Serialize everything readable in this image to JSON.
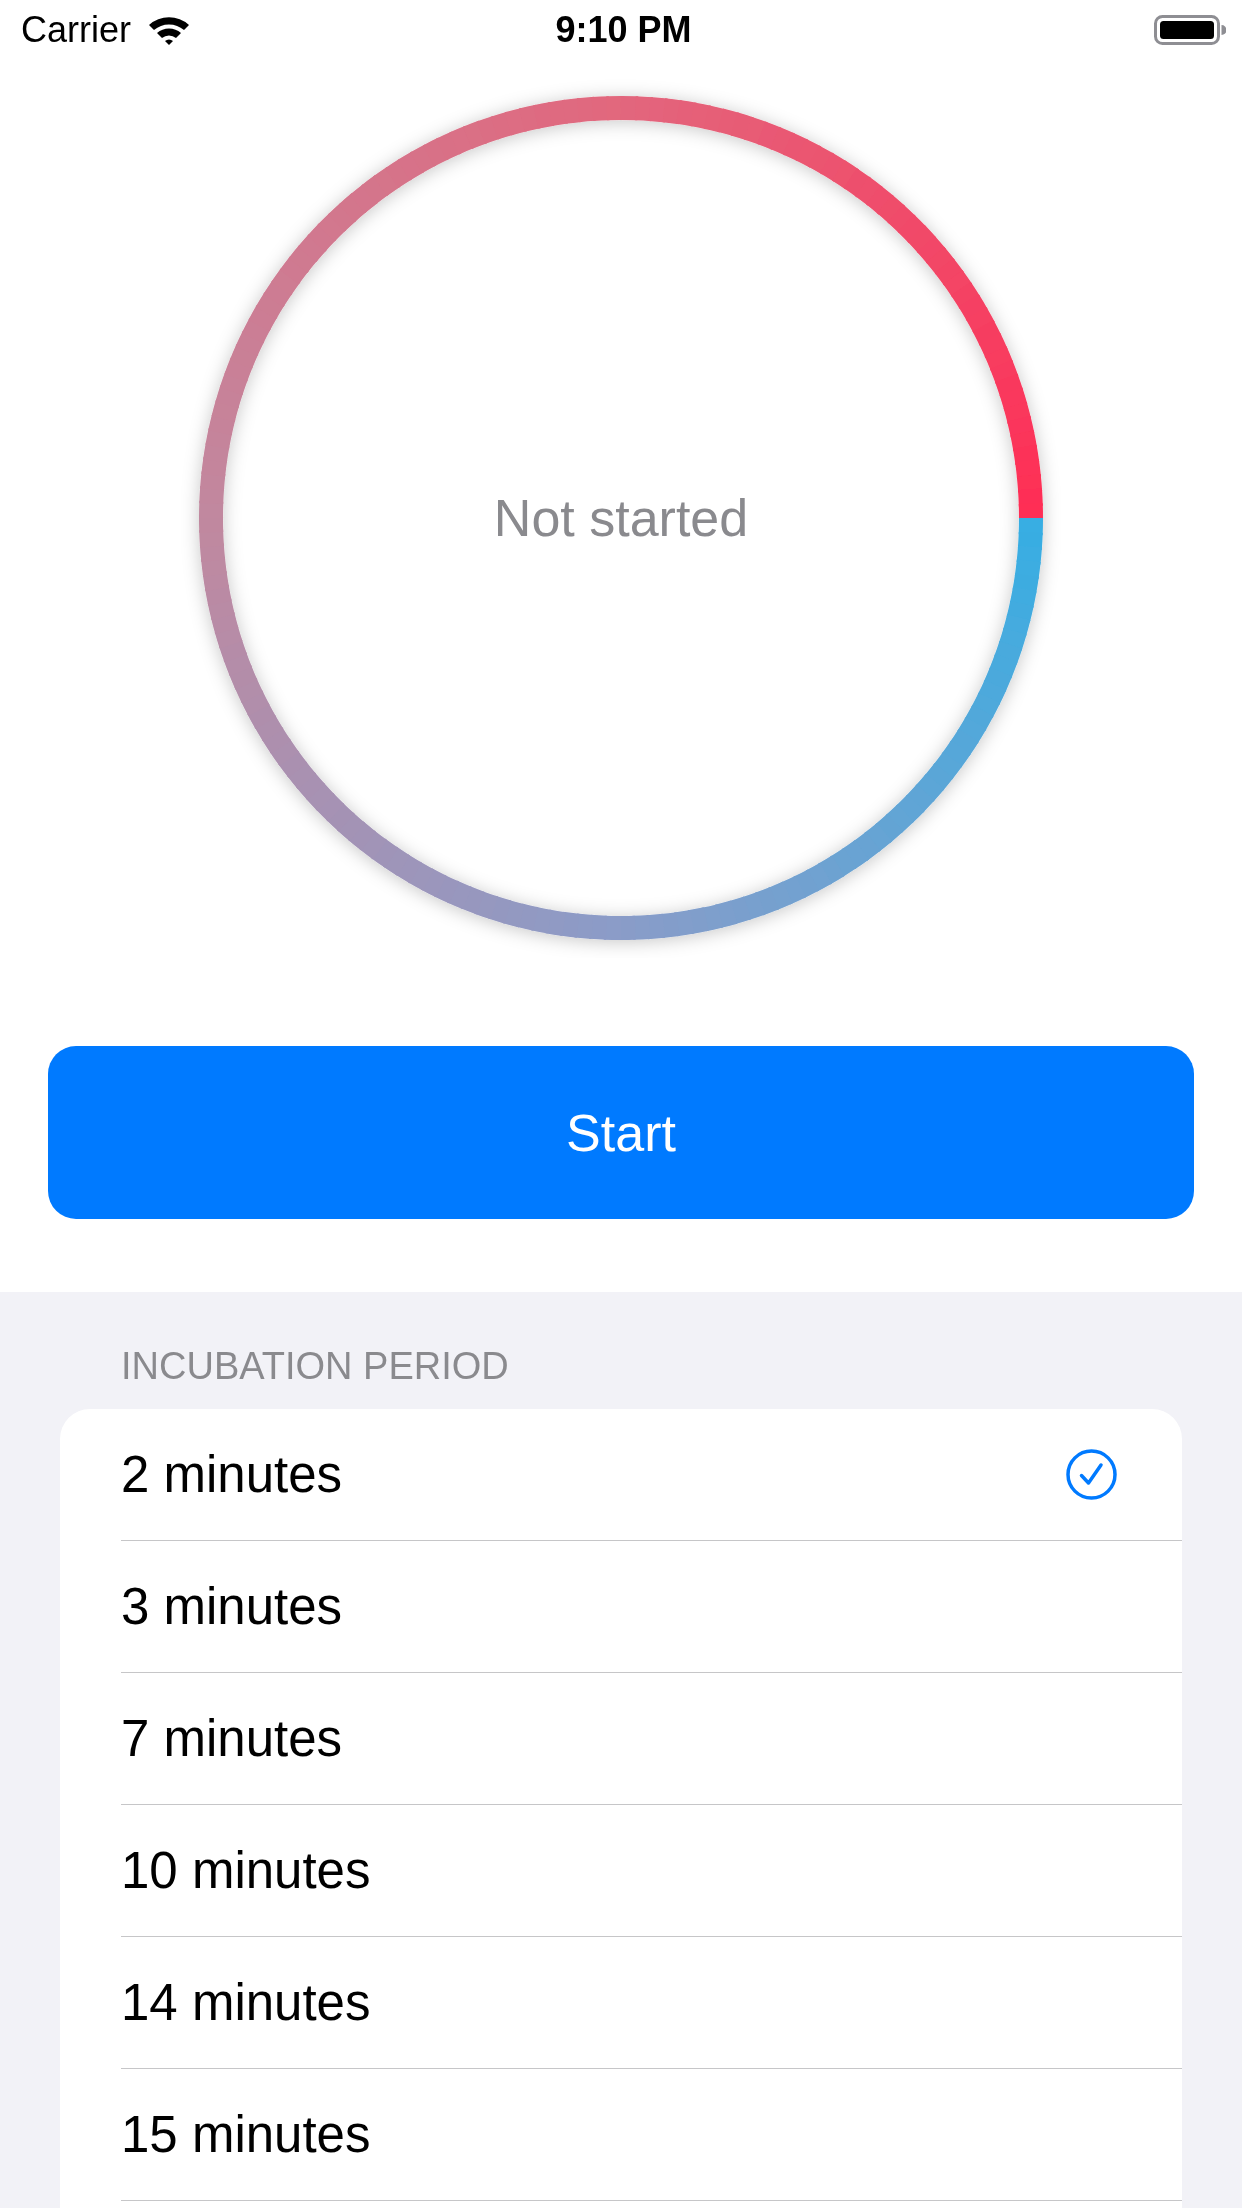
{
  "status_bar": {
    "carrier": "Carrier",
    "time": "9:10 PM"
  },
  "timer": {
    "status": "Not started"
  },
  "start_button": {
    "label": "Start"
  },
  "incubation": {
    "header": "INCUBATION PERIOD",
    "options": [
      {
        "label": "2 minutes",
        "selected": true
      },
      {
        "label": "3 minutes",
        "selected": false
      },
      {
        "label": "7 minutes",
        "selected": false
      },
      {
        "label": "10 minutes",
        "selected": false
      },
      {
        "label": "14 minutes",
        "selected": false
      },
      {
        "label": "15 minutes",
        "selected": false
      }
    ]
  }
}
